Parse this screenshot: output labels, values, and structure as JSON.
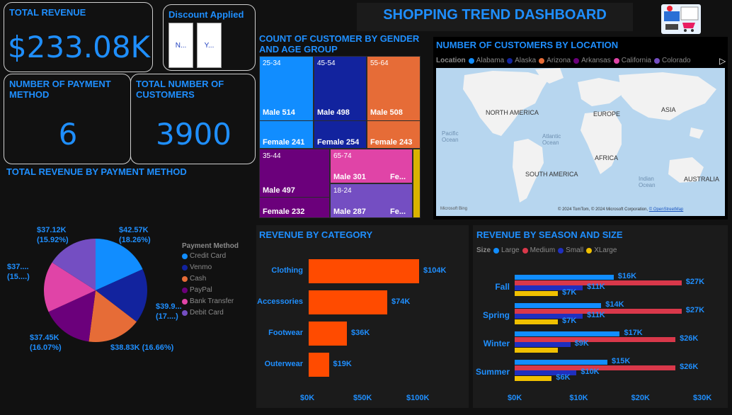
{
  "header": {
    "title": "SHOPPING TREND DASHBOARD",
    "logo_icon": "shopping-cart-logo-icon"
  },
  "kpis": {
    "total_revenue": {
      "label": "TOTAL REVENUE",
      "value": "$233.08K"
    },
    "payment_methods": {
      "label": "NUMBER OF PAYMENT METHOD",
      "value": "6"
    },
    "total_customers": {
      "label": "TOTAL NUMBER OF CUSTOMERS",
      "value": "3900"
    }
  },
  "discount_slicer": {
    "title": "Discount Applied",
    "options": [
      "N...",
      "Y..."
    ]
  },
  "treemap": {
    "title": "COUNT OF CUSTOMER BY GENDER AND AGE GROUP",
    "cells": [
      {
        "age": "25-34",
        "male": "Male 514",
        "female": "Female 241",
        "color": "#118dff"
      },
      {
        "age": "45-54",
        "male": "Male 498",
        "female": "Female 254",
        "color": "#12239e"
      },
      {
        "age": "55-64",
        "male": "Male 508",
        "female": "Female 243",
        "color": "#e66c37"
      },
      {
        "age": "35-44",
        "male": "Male 497",
        "female": "Female 232",
        "color": "#6b007b"
      },
      {
        "age": "65-74",
        "male": "Male 301",
        "female": "Fe...",
        "color": "#e044a7"
      },
      {
        "age": "18-24",
        "male": "Male 287",
        "female": "Fe...",
        "color": "#744ec2"
      }
    ],
    "extra_color": "#d9b300"
  },
  "map": {
    "title": "NUMBER OF CUSTOMERS BY LOCATION",
    "legend_title": "Location",
    "legend": [
      {
        "label": "Alabama",
        "color": "#118dff"
      },
      {
        "label": "Alaska",
        "color": "#12239e"
      },
      {
        "label": "Arizona",
        "color": "#e66c37"
      },
      {
        "label": "Arkansas",
        "color": "#6b007b"
      },
      {
        "label": "California",
        "color": "#e044a7"
      },
      {
        "label": "Colorado",
        "color": "#744ec2"
      }
    ],
    "regions": [
      "NORTH AMERICA",
      "EUROPE",
      "ASIA",
      "AFRICA",
      "SOUTH AMERICA",
      "AUSTRALIA"
    ],
    "oceans": [
      "Pacific Ocean",
      "Atlantic Ocean",
      "Indian Ocean"
    ],
    "attribution": "© 2024 TomTom, © 2024 Microsoft Corporation,",
    "attribution_link": "© OpenStreetMap",
    "bing": "Microsoft Bing"
  },
  "pie": {
    "title": "TOTAL REVENUE BY PAYMENT METHOD",
    "legend_title": "Payment Method",
    "slices": [
      {
        "label": "Credit Card",
        "value": 42.57,
        "color": "#118dff",
        "text": "$42.57K\n(18.26%)"
      },
      {
        "label": "Venmo",
        "value": 39.9,
        "color": "#12239e",
        "text": "$39.9...\n(17....)"
      },
      {
        "label": "Cash",
        "value": 38.83,
        "color": "#e66c37",
        "text": "$38.83K (16.66%)"
      },
      {
        "label": "PayPal",
        "value": 37.45,
        "color": "#6b007b",
        "text": "$37.45K\n(16.07%)"
      },
      {
        "label": "Bank Transfer",
        "value": 37.0,
        "color": "#e044a7",
        "text": "$37....\n(15....)"
      },
      {
        "label": "Debit Card",
        "value": 37.12,
        "color": "#744ec2",
        "text": "$37.12K\n(15.92%)"
      }
    ]
  },
  "category": {
    "title": "REVENUE BY CATEGORY",
    "bar_color": "#ff4b00",
    "xmax": 100,
    "bars": [
      {
        "label": "Clothing",
        "value": 104,
        "text": "$104K"
      },
      {
        "label": "Accessories",
        "value": 74,
        "text": "$74K"
      },
      {
        "label": "Footwear",
        "value": 36,
        "text": "$36K"
      },
      {
        "label": "Outerwear",
        "value": 19,
        "text": "$19K"
      }
    ],
    "ticks": [
      "$0K",
      "$50K",
      "$100K"
    ]
  },
  "season": {
    "title": "REVENUE BY SEASON AND SIZE",
    "legend_title": "Size",
    "xmax": 30,
    "sizes": [
      {
        "label": "Large",
        "color": "#118dff"
      },
      {
        "label": "Medium",
        "color": "#d9384a"
      },
      {
        "label": "Small",
        "color": "#1f2fbf"
      },
      {
        "label": "XLarge",
        "color": "#f0c000"
      }
    ],
    "groups": [
      {
        "label": "Fall",
        "values": [
          16,
          27,
          11,
          7
        ],
        "texts": [
          "$16K",
          "$27K",
          "$11K",
          "$7K"
        ]
      },
      {
        "label": "Spring",
        "values": [
          14,
          27,
          11,
          7
        ],
        "texts": [
          "$14K",
          "$27K",
          "$11K",
          "$7K"
        ]
      },
      {
        "label": "Winter",
        "values": [
          17,
          26,
          9,
          7
        ],
        "texts": [
          "$17K",
          "$26K",
          "$9K",
          ""
        ]
      },
      {
        "label": "Summer",
        "values": [
          15,
          26,
          10,
          6
        ],
        "texts": [
          "$15K",
          "$26K",
          "$10K",
          "$6K"
        ]
      }
    ],
    "ticks": [
      "$0K",
      "$10K",
      "$20K",
      "$30K"
    ]
  },
  "chart_data": [
    {
      "type": "pie",
      "title": "TOTAL REVENUE BY PAYMENT METHOD",
      "categories": [
        "Credit Card",
        "Venmo",
        "Cash",
        "PayPal",
        "Bank Transfer",
        "Debit Card"
      ],
      "values": [
        42.57,
        39.9,
        38.83,
        37.45,
        37.0,
        37.12
      ]
    },
    {
      "type": "bar",
      "title": "REVENUE BY CATEGORY",
      "categories": [
        "Clothing",
        "Accessories",
        "Footwear",
        "Outerwear"
      ],
      "values": [
        104,
        74,
        36,
        19
      ],
      "xlim": [
        0,
        100
      ]
    },
    {
      "type": "bar",
      "title": "REVENUE BY SEASON AND SIZE",
      "categories": [
        "Fall",
        "Spring",
        "Winter",
        "Summer"
      ],
      "series": [
        {
          "name": "Large",
          "values": [
            16,
            14,
            17,
            15
          ]
        },
        {
          "name": "Medium",
          "values": [
            27,
            27,
            26,
            26
          ]
        },
        {
          "name": "Small",
          "values": [
            11,
            11,
            9,
            10
          ]
        },
        {
          "name": "XLarge",
          "values": [
            7,
            7,
            7,
            6
          ]
        }
      ],
      "xlim": [
        0,
        30
      ]
    }
  ]
}
